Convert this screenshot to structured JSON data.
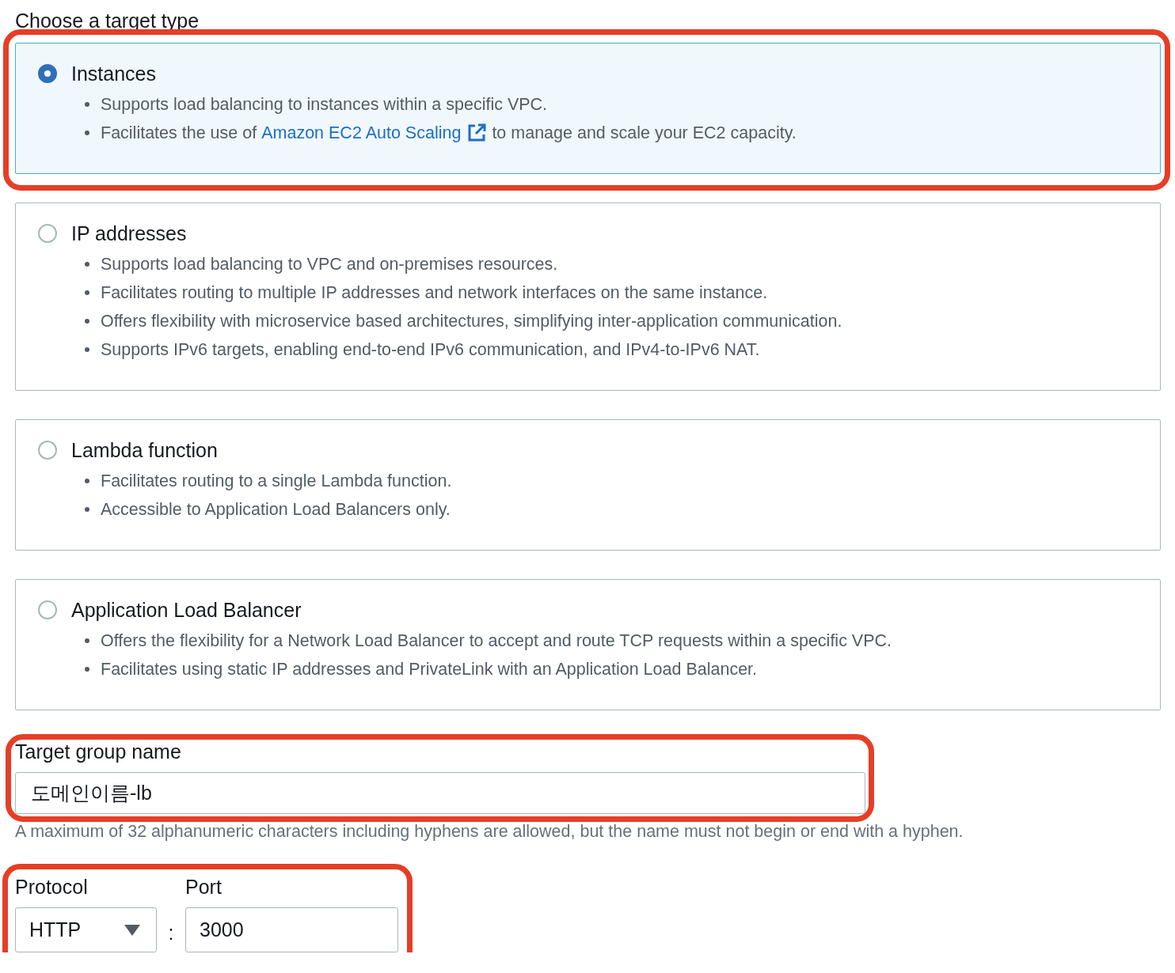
{
  "section_label": "Choose a target type",
  "target_types": [
    {
      "title": "Instances",
      "selected": true,
      "highlighted": true,
      "bullets": [
        {
          "text": "Supports load balancing to instances within a specific VPC."
        },
        {
          "text": "Facilitates the use of",
          "link": "Amazon EC2 Auto Scaling",
          "text_after": "to manage and scale your EC2 capacity."
        }
      ]
    },
    {
      "title": "IP addresses",
      "selected": false,
      "highlighted": false,
      "bullets": [
        {
          "text": "Supports load balancing to VPC and on-premises resources."
        },
        {
          "text": "Facilitates routing to multiple IP addresses and network interfaces on the same instance."
        },
        {
          "text": "Offers flexibility with microservice based architectures, simplifying inter-application communication."
        },
        {
          "text": "Supports IPv6 targets, enabling end-to-end IPv6 communication, and IPv4-to-IPv6 NAT."
        }
      ]
    },
    {
      "title": "Lambda function",
      "selected": false,
      "highlighted": false,
      "bullets": [
        {
          "text": "Facilitates routing to a single Lambda function."
        },
        {
          "text": "Accessible to Application Load Balancers only."
        }
      ]
    },
    {
      "title": "Application Load Balancer",
      "selected": false,
      "highlighted": false,
      "bullets": [
        {
          "text": "Offers the flexibility for a Network Load Balancer to accept and route TCP requests within a specific VPC."
        },
        {
          "text": "Facilitates using static IP addresses and PrivateLink with an Application Load Balancer."
        }
      ]
    }
  ],
  "name_field": {
    "label": "Target group name",
    "value": "도메인이름-lb",
    "highlighted": true,
    "hint": "A maximum of 32 alphanumeric characters including hyphens are allowed, but the name must not begin or end with a hyphen."
  },
  "listener": {
    "highlighted": true,
    "protocol": {
      "label": "Protocol",
      "value": "HTTP"
    },
    "separator": ":",
    "port": {
      "label": "Port",
      "value": "3000"
    }
  }
}
